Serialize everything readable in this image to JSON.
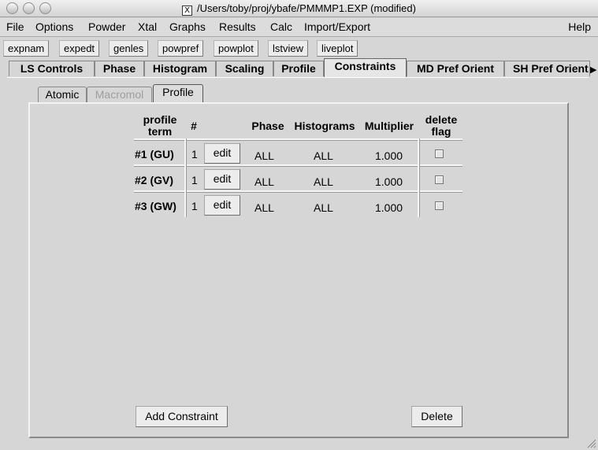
{
  "window": {
    "title": "/Users/toby/proj/ybafe/PMMMP1.EXP (modified)"
  },
  "menu": [
    "File",
    "Options",
    "Powder",
    "Xtal",
    "Graphs",
    "Results",
    "Calc",
    "Import/Export"
  ],
  "menu_help": "Help",
  "toolbar": [
    "expnam",
    "expedt",
    "genles",
    "powpref",
    "powplot",
    "lstview",
    "liveplot"
  ],
  "tabs": [
    "LS Controls",
    "Phase",
    "Histogram",
    "Scaling",
    "Profile",
    "Constraints",
    "MD Pref Orient",
    "SH Pref Orient"
  ],
  "active_tab": "Constraints",
  "subtabs": [
    "Atomic",
    "Macromol",
    "Profile"
  ],
  "active_subtab": "Profile",
  "disabled_subtab": "Macromol",
  "table": {
    "headers": {
      "profile_term": "profile\nterm",
      "num": "#",
      "phase": "Phase",
      "histograms": "Histograms",
      "multiplier": "Multiplier",
      "delete_flag": "delete\nflag"
    },
    "headers_split": {
      "profile_1": "profile",
      "profile_2": "term",
      "delete_1": "delete",
      "delete_2": "flag"
    },
    "edit_label": "edit",
    "rows": [
      {
        "term": "#1  (GU)",
        "num": "1",
        "phase": "ALL",
        "histograms": "ALL",
        "multiplier": "1.000",
        "delete": false
      },
      {
        "term": "#2  (GV)",
        "num": "1",
        "phase": "ALL",
        "histograms": "ALL",
        "multiplier": "1.000",
        "delete": false
      },
      {
        "term": "#3  (GW)",
        "num": "1",
        "phase": "ALL",
        "histograms": "ALL",
        "multiplier": "1.000",
        "delete": false
      }
    ]
  },
  "buttons": {
    "add_constraint": "Add Constraint",
    "delete": "Delete"
  }
}
